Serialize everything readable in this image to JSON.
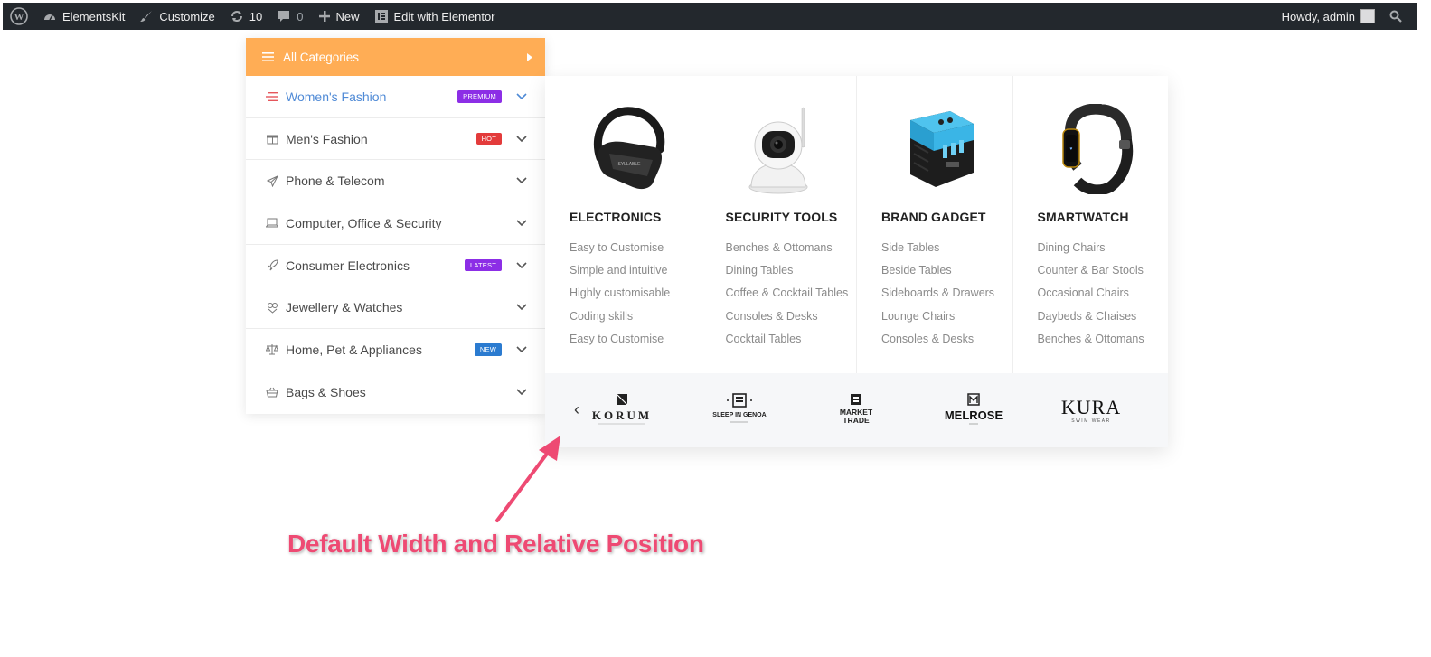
{
  "adminbar": {
    "site_name": "ElementsKit",
    "customize": "Customize",
    "updates_count": "10",
    "comments_count": "0",
    "new_label": "New",
    "edit_label": "Edit with Elementor",
    "howdy": "Howdy, admin"
  },
  "menu": {
    "header_label": "All Categories",
    "header_color": "#ffad55",
    "items": [
      {
        "label": "Women's Fashion",
        "badge": "PREMIUM",
        "badge_color": "#8c2ee6",
        "icon": "lines-icon"
      },
      {
        "label": "Men's Fashion",
        "badge": "HOT",
        "badge_color": "#e33b3b",
        "icon": "gift-icon"
      },
      {
        "label": "Phone & Telecom",
        "badge": "",
        "icon": "paper-plane-icon"
      },
      {
        "label": "Computer, Office & Security",
        "badge": "",
        "icon": "laptop-icon"
      },
      {
        "label": "Consumer Electronics",
        "badge": "LATEST",
        "badge_color": "#8c2ee6",
        "icon": "rocket-icon"
      },
      {
        "label": "Jewellery & Watches",
        "badge": "",
        "icon": "jewel-icon"
      },
      {
        "label": "Home, Pet & Appliances",
        "badge": "NEW",
        "badge_color": "#2b7bd0",
        "icon": "scale-icon"
      },
      {
        "label": "Bags & Shoes",
        "badge": "",
        "icon": "basket-icon"
      }
    ]
  },
  "mega": {
    "columns": [
      {
        "title": "ELECTRONICS",
        "image": "earbud-icon",
        "links": [
          "Easy to Customise",
          "Simple and intuitive",
          "Highly customisable",
          "Coding skills",
          "Easy to Customise"
        ]
      },
      {
        "title": "SECURITY TOOLS",
        "image": "security-camera-icon",
        "links": [
          "Benches & Ottomans",
          "Dining Tables",
          "Coffee & Cocktail Tables",
          "Consoles & Desks",
          "Cocktail Tables"
        ]
      },
      {
        "title": "BRAND GADGET",
        "image": "travel-adapter-icon",
        "links": [
          "Side Tables",
          "Beside Tables",
          "Sideboards & Drawers",
          "Lounge Chairs",
          "Consoles & Desks"
        ]
      },
      {
        "title": "SMARTWATCH",
        "image": "smartwatch-icon",
        "links": [
          "Dining Chairs",
          "Counter & Bar Stools",
          "Occasional Chairs",
          "Daybeds & Chaises",
          "Benches & Ottomans"
        ]
      }
    ],
    "brands": [
      {
        "name": "KORUM"
      },
      {
        "name": "SLEEP IN GENOA"
      },
      {
        "name": "MARKET TRADE"
      },
      {
        "name": "MELROSE"
      },
      {
        "name": "KURA",
        "sub": "SWIM WEAR"
      }
    ]
  },
  "annotation": {
    "text": "Default Width and Relative Position",
    "color": "#ee4a73"
  }
}
